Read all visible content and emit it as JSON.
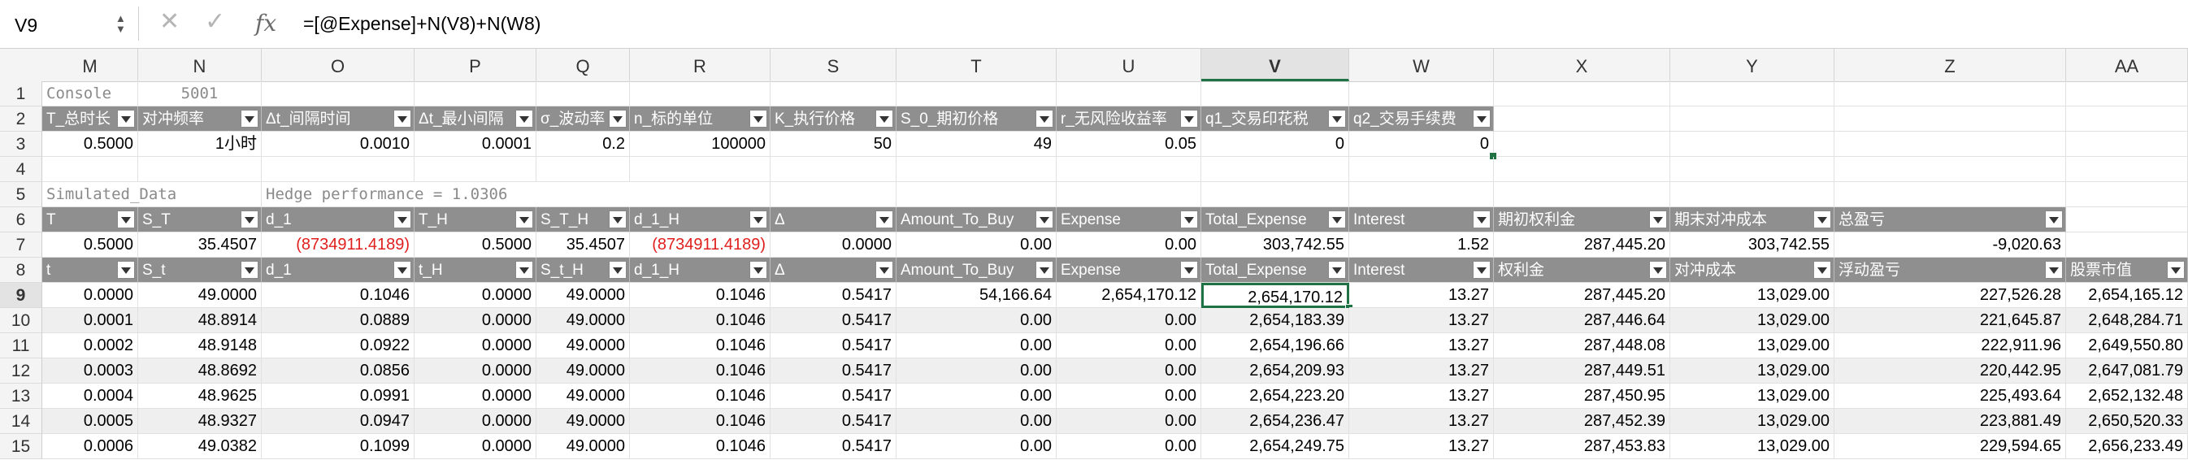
{
  "formula_bar": {
    "name_box": "V9",
    "formula": "=[@Expense]+N(V8)+N(W8)"
  },
  "columns": [
    "M",
    "N",
    "O",
    "P",
    "Q",
    "R",
    "S",
    "T",
    "U",
    "V",
    "W",
    "X",
    "Y",
    "Z",
    "AA"
  ],
  "selected_column": "V",
  "selected_row": "9",
  "row_numbers": [
    "1",
    "2",
    "3",
    "4",
    "5",
    "6",
    "7",
    "8",
    "9",
    "10",
    "11",
    "12",
    "13",
    "14",
    "15"
  ],
  "row1": {
    "console": "Console",
    "value": "5001"
  },
  "row2_headers": [
    "T_总时长",
    "对冲频率",
    "Δt_间隔时间",
    "Δt_最小间隔",
    "σ_波动率",
    "n_标的单位",
    "K_执行价格",
    "S_0_期初价格",
    "r_无风险收益率",
    "q1_交易印花税",
    "q2_交易手续费"
  ],
  "row3_values": [
    "0.5000",
    "1小时",
    "0.0010",
    "0.0001",
    "0.2",
    "100000",
    "50",
    "49",
    "0.05",
    "0",
    "0"
  ],
  "row5": {
    "simulated": "Simulated_Data",
    "hedge": "Hedge performance = 1.0306"
  },
  "row6_headers": [
    "T",
    "S_T",
    "d_1",
    "T_H",
    "S_T_H",
    "d_1_H",
    "Δ",
    "Amount_To_Buy",
    "Expense",
    "Total_Expense",
    "Interest",
    "期初权利金",
    "期末对冲成本",
    "总盈亏"
  ],
  "row7_values": [
    "0.5000",
    "35.4507",
    "(8734911.4189)",
    "0.5000",
    "35.4507",
    "(8734911.4189)",
    "0.0000",
    "0.00",
    "0.00",
    "303,742.55",
    "1.52",
    "287,445.20",
    "303,742.55",
    "-9,020.63"
  ],
  "row8_headers": [
    "t",
    "S_t",
    "d_1",
    "t_H",
    "S_t_H",
    "d_1_H",
    "Δ",
    "Amount_To_Buy",
    "Expense",
    "Total_Expense",
    "Interest",
    "权利金",
    "对冲成本",
    "浮动盈亏",
    "股票市值"
  ],
  "data_rows": [
    [
      "0.0000",
      "49.0000",
      "0.1046",
      "0.0000",
      "49.0000",
      "0.1046",
      "0.5417",
      "54,166.64",
      "2,654,170.12",
      "2,654,170.12",
      "13.27",
      "287,445.20",
      "13,029.00",
      "227,526.28",
      "2,654,165.12"
    ],
    [
      "0.0001",
      "48.8914",
      "0.0889",
      "0.0000",
      "49.0000",
      "0.1046",
      "0.5417",
      "0.00",
      "0.00",
      "2,654,183.39",
      "13.27",
      "287,446.64",
      "13,029.00",
      "221,645.87",
      "2,648,284.71"
    ],
    [
      "0.0002",
      "48.9148",
      "0.0922",
      "0.0000",
      "49.0000",
      "0.1046",
      "0.5417",
      "0.00",
      "0.00",
      "2,654,196.66",
      "13.27",
      "287,448.08",
      "13,029.00",
      "222,911.96",
      "2,649,550.80"
    ],
    [
      "0.0003",
      "48.8692",
      "0.0856",
      "0.0000",
      "49.0000",
      "0.1046",
      "0.5417",
      "0.00",
      "0.00",
      "2,654,209.93",
      "13.27",
      "287,449.51",
      "13,029.00",
      "220,442.95",
      "2,647,081.79"
    ],
    [
      "0.0004",
      "48.9625",
      "0.0991",
      "0.0000",
      "49.0000",
      "0.1046",
      "0.5417",
      "0.00",
      "0.00",
      "2,654,223.20",
      "13.27",
      "287,450.95",
      "13,029.00",
      "225,493.64",
      "2,652,132.48"
    ],
    [
      "0.0005",
      "48.9327",
      "0.0947",
      "0.0000",
      "49.0000",
      "0.1046",
      "0.5417",
      "0.00",
      "0.00",
      "2,654,236.47",
      "13.27",
      "287,452.39",
      "13,029.00",
      "223,881.49",
      "2,650,520.33"
    ],
    [
      "0.0006",
      "49.0382",
      "0.1099",
      "0.0000",
      "49.0000",
      "0.1046",
      "0.5417",
      "0.00",
      "0.00",
      "2,654,249.75",
      "13.27",
      "287,453.83",
      "13,029.00",
      "229,594.65",
      "2,656,233.49"
    ]
  ]
}
